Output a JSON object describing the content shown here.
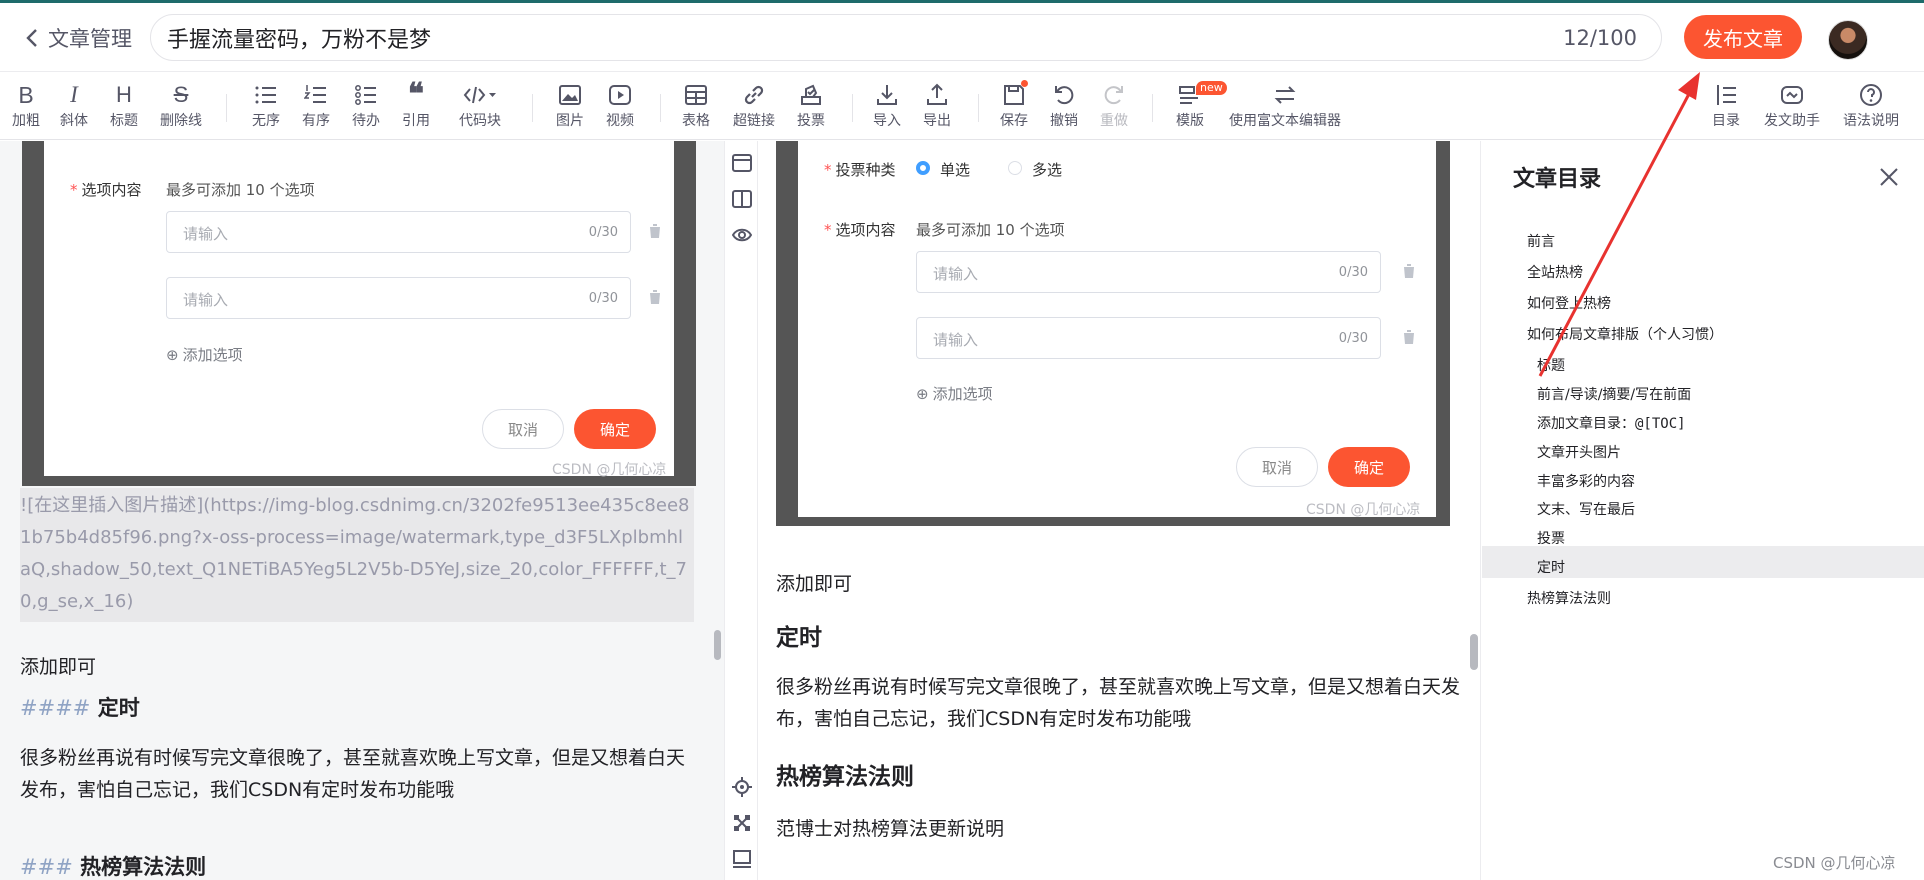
{
  "header": {
    "back_label": "文章管理",
    "title_value": "手握流量密码，万粉不是梦",
    "title_count": "12/100",
    "publish_label": "发布文章"
  },
  "toolbar": {
    "bold": "加粗",
    "italic": "斜体",
    "heading": "标题",
    "strike": "删除线",
    "ul": "无序",
    "ol": "有序",
    "todo": "待办",
    "quote": "引用",
    "code": "代码块",
    "image": "图片",
    "video": "视频",
    "table": "表格",
    "link": "超链接",
    "vote": "投票",
    "import": "导入",
    "export": "导出",
    "save": "保存",
    "undo": "撤销",
    "redo": "重做",
    "template": "模版",
    "template_badge": "new",
    "richtext": "使用富文本编辑器",
    "toc": "目录",
    "assistant": "发文助手",
    "grammar": "语法说明",
    "glyph_bold": "B",
    "glyph_italic": "I",
    "glyph_heading": "H",
    "glyph_strike": "S"
  },
  "dialog": {
    "vote_type_label": "投票种类",
    "single_label": "单选",
    "multi_label": "多选",
    "options_label": "选项内容",
    "options_tip": "最多可添加 10 个选项",
    "input_placeholder": "请输入",
    "input_count": "0/30",
    "add_option": "添加选项",
    "cancel": "取消",
    "ok": "确定",
    "watermark": "CSDN @几何心凉"
  },
  "editor": {
    "md_image": "![在这里插入图片描述](https://img-blog.csdnimg.cn/3202fe9513ee435c8ee81b75b4d85f96.png?x-oss-process=image/watermark,type_d3F5LXplbmhlaQ,shadow_50,text_Q1NETiBA5Yeg5L2V5b-D5YeJ,size_20,color_FFFFFF,t_70,g_se,x_16)",
    "add_ok": "添加即可",
    "h4_marker": "####",
    "h4_text": "定时",
    "para": "很多粉丝再说有时候写完文章很晚了，甚至就喜欢晚上写文章，但是又想着白天发布，害怕自己忘记，我们CSDN有定时发布功能哦",
    "h3_marker": "###",
    "h3_text": "热榜算法法则"
  },
  "preview": {
    "add_ok": "添加即可",
    "h_timer": "定时",
    "para": "很多粉丝再说有时候写完文章很晚了，甚至就喜欢晚上写文章，但是又想着白天发布，害怕自己忘记，我们CSDN有定时发布功能哦",
    "h_hot": "热榜算法法则",
    "para2": "范博士对热榜算法更新说明"
  },
  "toc": {
    "title": "文章目录",
    "items": [
      {
        "label": "前言"
      },
      {
        "label": "全站热榜"
      },
      {
        "label": "如何登上热榜"
      },
      {
        "label": "如何布局文章排版（个人习惯）"
      },
      {
        "label": "标题"
      },
      {
        "label": "前言/导读/摘要/写在前面"
      },
      {
        "label": "添加文章目录：@[TOC]"
      },
      {
        "label": "文章开头图片"
      },
      {
        "label": "丰富多彩的内容"
      },
      {
        "label": "文末、写在最后"
      },
      {
        "label": "投票"
      },
      {
        "label": "定时"
      },
      {
        "label": "热榜算法法则"
      }
    ],
    "active_index": 11
  },
  "footer_watermark": "CSDN @几何心凉",
  "colors": {
    "accent": "#fc5531",
    "radio_blue": "#409eff",
    "annotation_red": "#e8322f"
  }
}
